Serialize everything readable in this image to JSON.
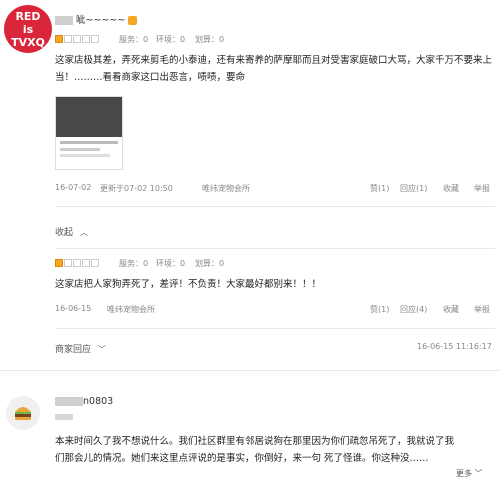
{
  "reviews": [
    {
      "username": "呲~~~~~",
      "rating": 1,
      "scores": [
        "服务：0",
        "环境：0",
        "划算：0"
      ],
      "text": "这家店极其差，弄死来剪毛的小泰迪，还有来寄养的萨摩耶而且对受害家庭破口大骂，大家千万不要来上当！………看看商家这口出恶言，啧啧，要命",
      "date": "16-07-02",
      "updated": "更新于07-02 10:50",
      "shop": "唯纬宠物会所",
      "actions": [
        "赞(1)",
        "回应(1)",
        "收藏",
        "举报"
      ],
      "collapse": "收起"
    },
    {
      "rating": 1,
      "scores": [
        "服务：0",
        "环境：0",
        "划算：0"
      ],
      "text": "这家店把人家狗弄死了，差评！不负责！大家最好都别来！！！",
      "date": "16-06-15",
      "shop": "唯纬宠物会所",
      "actions": [
        "赞(1)",
        "回应(4)",
        "收藏",
        "举报"
      ],
      "merchant_reply": "商家回应",
      "reply_time": "16-06-15 11:16:17"
    },
    {
      "username": "n0803",
      "text_line1": "本来时间久了我不想说什么。我们社区群里有邻居说狗在那里因为你们疏忽吊死了，我就说了我",
      "text_line2": "们那会儿的情况。她们来这里点评说的是事实，你倒好，来一句 死了怪谁。你这种没……",
      "more": "更多"
    }
  ],
  "badge": {
    "line1": "RED",
    "line2": "is",
    "line3": "TVXQ"
  }
}
